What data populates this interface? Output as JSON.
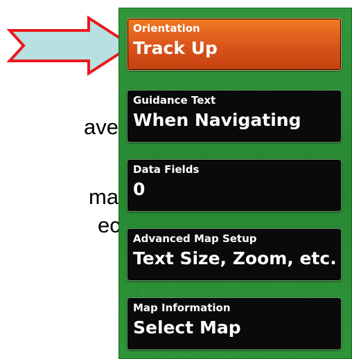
{
  "background_text": {
    "line1": "avel",
    "line2": "map",
    "line3": "ect"
  },
  "colors": {
    "panel_green": "#238a2e",
    "selected_orange": "#d9531a",
    "arrow_fill": "#b8e0e0",
    "arrow_outline": "#e8191d"
  },
  "menu": {
    "items": [
      {
        "label": "Orientation",
        "value": "Track Up",
        "selected": true
      },
      {
        "label": "Guidance Text",
        "value": "When Navigating",
        "selected": false
      },
      {
        "label": "Data Fields",
        "value": "0",
        "selected": false
      },
      {
        "label": "Advanced Map Setup",
        "value": "Text Size, Zoom, etc.",
        "selected": false
      },
      {
        "label": "Map Information",
        "value": "Select Map",
        "selected": false
      }
    ]
  }
}
